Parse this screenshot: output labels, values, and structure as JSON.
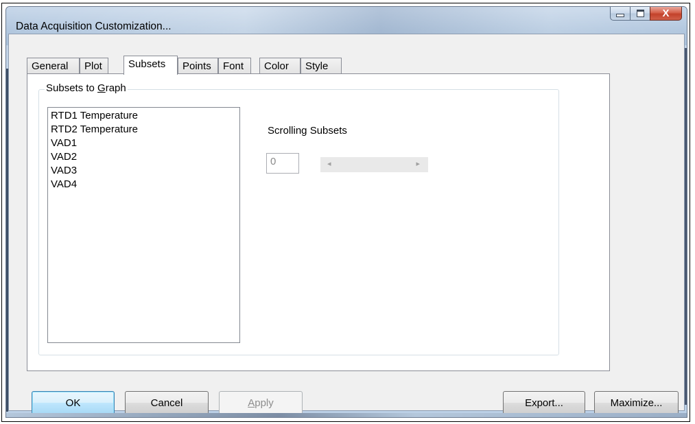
{
  "window": {
    "title": "Data Acquisition Customization..."
  },
  "tabs": [
    {
      "label": "General"
    },
    {
      "label": "Plot"
    },
    {
      "label": "Subsets",
      "active": true
    },
    {
      "label": "Points"
    },
    {
      "label": "Font"
    },
    {
      "label": "Color"
    },
    {
      "label": "Style"
    }
  ],
  "subsets_group": {
    "label_prefix": "Subsets to ",
    "label_mnemonic": "G",
    "label_suffix": "raph",
    "items": [
      "RTD1 Temperature",
      "RTD2 Temperature",
      "VAD1",
      "VAD2",
      "VAD3",
      "VAD4"
    ]
  },
  "scrolling": {
    "label": "Scrolling Subsets",
    "value": "0",
    "left_arrow": "◂",
    "right_arrow": "▸"
  },
  "buttons": {
    "ok": "OK",
    "cancel": "Cancel",
    "apply_mnemonic": "A",
    "apply_rest": "pply",
    "export": "Export...",
    "maximize": "Maximize..."
  },
  "caption": {
    "minimize": "minimize-icon",
    "maximize": "maximize-icon",
    "close_glyph": "X"
  }
}
